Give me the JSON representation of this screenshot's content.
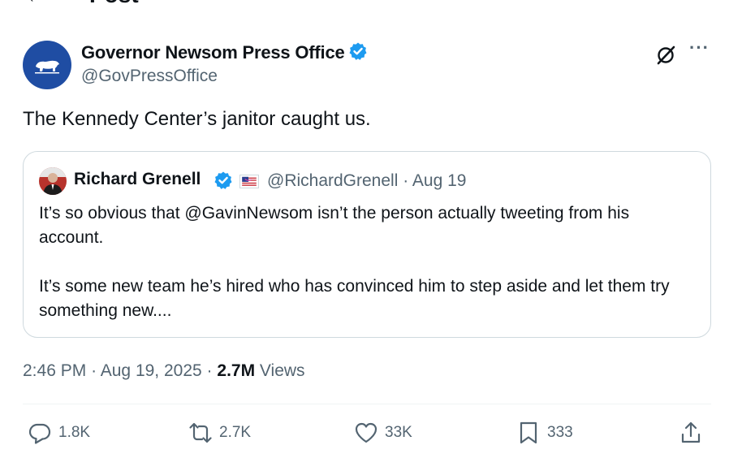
{
  "header": {
    "back_glyph": "←",
    "title": "Post"
  },
  "post": {
    "author_name": "Governor Newsom Press Office",
    "author_handle": "@GovPressOffice",
    "text": "The Kennedy Center’s janitor caught us.",
    "time": "2:46 PM",
    "date": "Aug 19, 2025",
    "views_count": "2.7M",
    "views_label": "Views",
    "sep": "·"
  },
  "quote": {
    "author_name": "Richard Grenell",
    "author_handle": "@RichardGrenell",
    "date": "Aug 19",
    "sep": "·",
    "paragraph1": "It’s so obvious that @GavinNewsom isn’t the person actually tweeting from his account.",
    "paragraph2": "It’s some new team he’s hired who has convinced him to step aside and let them try something new...."
  },
  "actions": {
    "replies": "1.8K",
    "reposts": "2.7K",
    "likes": "33K",
    "bookmarks": "333"
  },
  "colors": {
    "accent_blue": "#1d9bf0",
    "text_secondary": "#536471",
    "avatar_bg": "#1f4da3"
  },
  "icons": {
    "avatar": "california-bear-icon",
    "verified": "verified-badge-icon",
    "grok": "grok-icon",
    "more": "more-icon",
    "reply": "reply-icon",
    "repost": "repost-icon",
    "like": "heart-icon",
    "bookmark": "bookmark-icon",
    "share": "share-icon"
  }
}
